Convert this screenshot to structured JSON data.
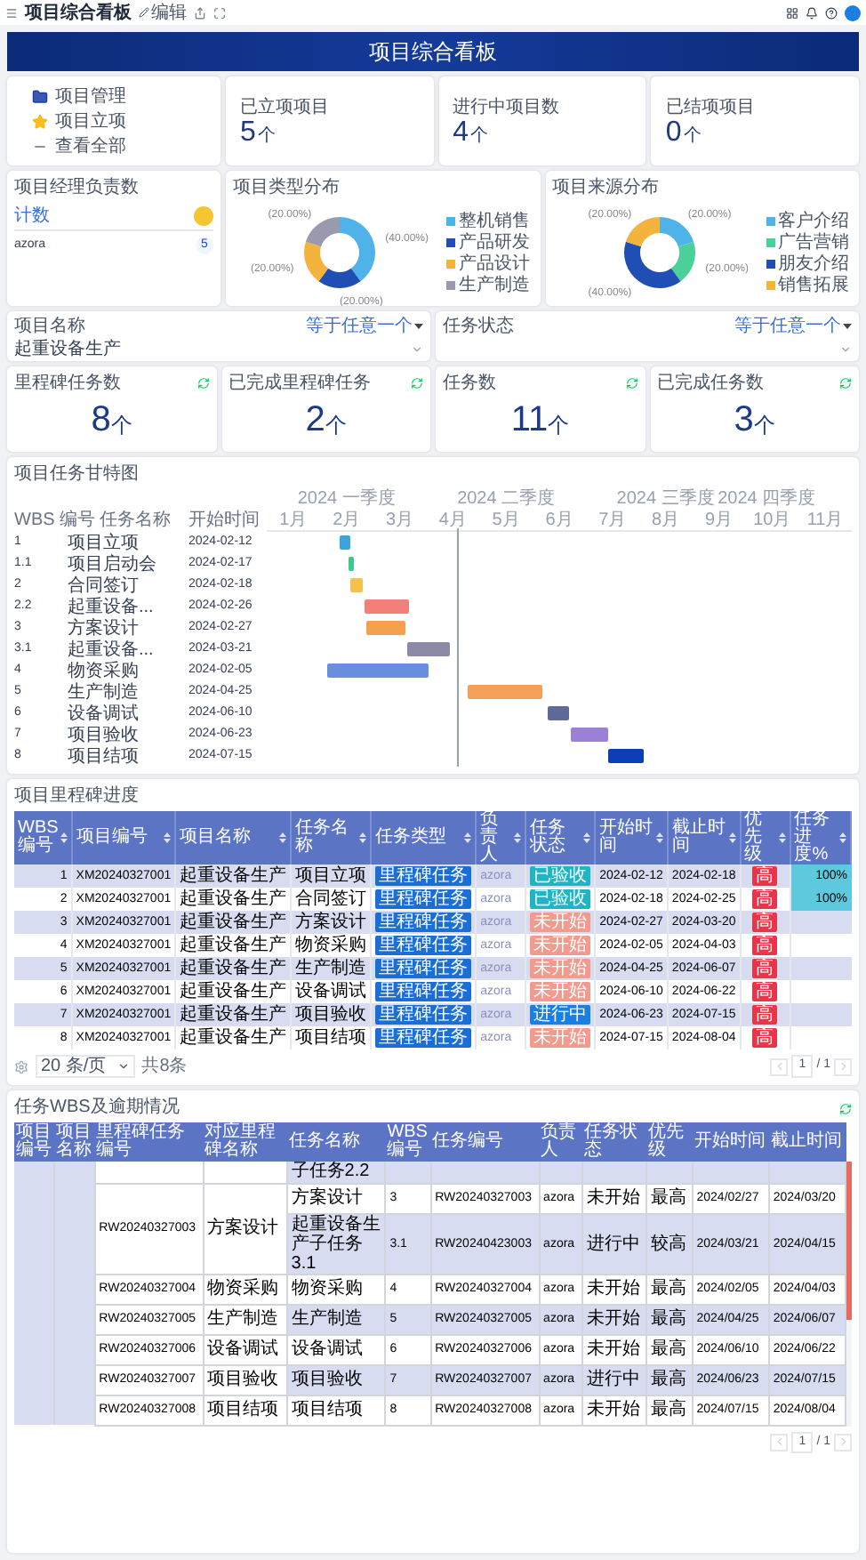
{
  "topbar": {
    "title": "项目综合看板",
    "edit": "编辑"
  },
  "banner": {
    "title": "项目综合看板"
  },
  "menu": [
    {
      "label": "项目管理",
      "kind": "folder"
    },
    {
      "label": "项目立项",
      "kind": "star"
    },
    {
      "label": "查看全部",
      "kind": "dash"
    }
  ],
  "stats": [
    {
      "label": "已立项项目",
      "value": "5",
      "unit": "个"
    },
    {
      "label": "进行中项目数",
      "value": "4",
      "unit": "个"
    },
    {
      "label": "已结项项目",
      "value": "0",
      "unit": "个"
    }
  ],
  "manager_counts": {
    "title": "项目经理负责数",
    "header": "计数",
    "rows": [
      {
        "name": "azora",
        "count": "5"
      }
    ]
  },
  "pies": [
    {
      "title": "项目类型分布",
      "chart_data": {
        "type": "donut",
        "categories": [
          "整机销售",
          "产品研发",
          "产品设计",
          "生产制造"
        ],
        "values": [
          40,
          20,
          20,
          20
        ],
        "legend": "right",
        "colors": [
          "#4fb3ea",
          "#1f4fb5",
          "#f3b33d",
          "#9a9aae"
        ],
        "value_labels": [
          "(40.00%)",
          "(20.00%)",
          "(20.00%)",
          "(20.00%)"
        ]
      }
    },
    {
      "title": "项目来源分布",
      "chart_data": {
        "type": "donut",
        "categories": [
          "客户介绍",
          "广告营销",
          "朋友介绍",
          "销售拓展"
        ],
        "values": [
          20,
          20,
          40,
          20
        ],
        "legend": "right",
        "colors": [
          "#4fb3ea",
          "#4cd09a",
          "#1f4fb5",
          "#f3b33d"
        ],
        "value_labels": [
          "(20.00%)",
          "(20.00%)",
          "(40.00%)",
          "(20.00%)"
        ]
      }
    }
  ],
  "filters": [
    {
      "label": "项目名称",
      "operator": "等于任意一个",
      "value": "起重设备生产"
    },
    {
      "label": "任务状态",
      "operator": "等于任意一个"
    }
  ],
  "counters": [
    {
      "label": "里程碑任务数",
      "value": "8",
      "unit": "个"
    },
    {
      "label": "已完成里程碑任务",
      "value": "2",
      "unit": "个"
    },
    {
      "label": "任务数",
      "value": "11",
      "unit": "个"
    },
    {
      "label": "已完成任务数",
      "value": "3",
      "unit": "个"
    }
  ],
  "gantt": {
    "title": "项目任务甘特图",
    "columns": [
      "WBS 编号",
      "任务名称",
      "开始时间"
    ],
    "quarters": [
      "2024 一季度",
      "2024 二季度",
      "2024 三季度",
      "2024 四季度"
    ],
    "months": [
      "1月",
      "2月",
      "3月",
      "4月",
      "5月",
      "6月",
      "7月",
      "8月",
      "9月",
      "10月",
      "11月"
    ],
    "tasks": [
      {
        "wbs": "1",
        "name": "项目立项",
        "start": "2024-02-12",
        "color": "#3ba4e0"
      },
      {
        "wbs": "1.1",
        "name": "项目启动会",
        "start": "2024-02-17",
        "color": "#3cc98a"
      },
      {
        "wbs": "2",
        "name": "合同签订",
        "start": "2024-02-18",
        "color": "#f5c04e"
      },
      {
        "wbs": "2.2",
        "name": "起重设备...",
        "start": "2024-02-26",
        "color": "#f27f7a"
      },
      {
        "wbs": "3",
        "name": "方案设计",
        "start": "2024-02-27",
        "color": "#f5a04f"
      },
      {
        "wbs": "3.1",
        "name": "起重设备...",
        "start": "2024-03-21",
        "color": "#8c8aa6"
      },
      {
        "wbs": "4",
        "name": "物资采购",
        "start": "2024-02-05",
        "color": "#6a8fe0"
      },
      {
        "wbs": "5",
        "name": "生产制造",
        "start": "2024-04-25",
        "color": "#f2a05a"
      },
      {
        "wbs": "6",
        "name": "设备调试",
        "start": "2024-06-10",
        "color": "#606a96"
      },
      {
        "wbs": "7",
        "name": "项目验收",
        "start": "2024-06-23",
        "color": "#9a80d6"
      },
      {
        "wbs": "8",
        "name": "项目结项",
        "start": "2024-07-15",
        "color": "#0b3fb5"
      }
    ]
  },
  "milestones": {
    "title": "项目里程碑进度",
    "columns": [
      "WBS编号",
      "项目编号",
      "项目名称",
      "任务名称",
      "任务类型",
      "负责人",
      "任务状态",
      "开始时间",
      "截止时间",
      "优先级",
      "任务进度%"
    ],
    "rows": [
      {
        "wbs": "1",
        "project_no": "XM20240327001",
        "project": "起重设备生产",
        "task": "项目立项",
        "type": "里程碑任务",
        "owner": "azora",
        "status": {
          "text": "已验收",
          "color": "#1fb5c4"
        },
        "start": "2024-02-12",
        "end": "2024-02-18",
        "priority": "高",
        "progress": {
          "text": "100%",
          "level": 1
        }
      },
      {
        "wbs": "2",
        "project_no": "XM20240327001",
        "project": "起重设备生产",
        "task": "合同签订",
        "type": "里程碑任务",
        "owner": "azora",
        "status": {
          "text": "已验收",
          "color": "#1fb5c4"
        },
        "start": "2024-02-18",
        "end": "2024-02-25",
        "priority": "高",
        "progress": {
          "text": "100%",
          "level": 1
        }
      },
      {
        "wbs": "3",
        "project_no": "XM20240327001",
        "project": "起重设备生产",
        "task": "方案设计",
        "type": "里程碑任务",
        "owner": "azora",
        "status": {
          "text": "未开始",
          "color": "#f29a8e"
        },
        "start": "2024-02-27",
        "end": "2024-03-20",
        "priority": "高"
      },
      {
        "wbs": "4",
        "project_no": "XM20240327001",
        "project": "起重设备生产",
        "task": "物资采购",
        "type": "里程碑任务",
        "owner": "azora",
        "status": {
          "text": "未开始",
          "color": "#f29a8e"
        },
        "start": "2024-02-05",
        "end": "2024-04-03",
        "priority": "高"
      },
      {
        "wbs": "5",
        "project_no": "XM20240327001",
        "project": "起重设备生产",
        "task": "生产制造",
        "type": "里程碑任务",
        "owner": "azora",
        "status": {
          "text": "未开始",
          "color": "#f29a8e"
        },
        "start": "2024-04-25",
        "end": "2024-06-07",
        "priority": "高"
      },
      {
        "wbs": "6",
        "project_no": "XM20240327001",
        "project": "起重设备生产",
        "task": "设备调试",
        "type": "里程碑任务",
        "owner": "azora",
        "status": {
          "text": "未开始",
          "color": "#f29a8e"
        },
        "start": "2024-06-10",
        "end": "2024-06-22",
        "priority": "高"
      },
      {
        "wbs": "7",
        "project_no": "XM20240327001",
        "project": "起重设备生产",
        "task": "项目验收",
        "type": "里程碑任务",
        "owner": "azora",
        "status": {
          "text": "进行中",
          "color": "#1a7fe0"
        },
        "start": "2024-06-23",
        "end": "2024-07-15",
        "priority": "高"
      },
      {
        "wbs": "8",
        "project_no": "XM20240327001",
        "project": "起重设备生产",
        "task": "项目结项",
        "type": "里程碑任务",
        "owner": "azora",
        "status": {
          "text": "未开始",
          "color": "#f29a8e"
        },
        "start": "2024-07-15",
        "end": "2024-08-04",
        "priority": "高"
      }
    ],
    "pagination": {
      "page_size": "20 条/页",
      "total": "共8条",
      "page": "1",
      "pages": "/ 1"
    }
  },
  "wbs": {
    "title": "任务WBS及逾期情况",
    "columns": [
      "项目编号",
      "项目名称",
      "里程碑任务编号",
      "对应里程碑名称",
      "任务名称",
      "WBS编号",
      "任务编号",
      "负责人",
      "任务状态",
      "优先级",
      "开始时间",
      "截止时间"
    ],
    "groups": [
      {
        "tasks": [
          {
            "name": "子任务2.2"
          }
        ]
      },
      {
        "milestone_no": "RW20240327003",
        "milestone": "方案设计",
        "tasks": [
          {
            "name": "方案设计",
            "wbs": "3",
            "task_no": "RW20240327003",
            "owner": "azora",
            "status": "未开始",
            "priority": "最高",
            "start": "2024/02/27",
            "end": "2024/03/20"
          },
          {
            "name": "起重设备生产子任务3.1",
            "wbs": "3.1",
            "task_no": "RW20240423003",
            "owner": "azora",
            "status": "进行中",
            "priority": "较高",
            "start": "2024/03/21",
            "end": "2024/04/15"
          }
        ]
      },
      {
        "milestone_no": "RW20240327004",
        "milestone": "物资采购",
        "tasks": [
          {
            "name": "物资采购",
            "wbs": "4",
            "task_no": "RW20240327004",
            "owner": "azora",
            "status": "未开始",
            "priority": "最高",
            "start": "2024/02/05",
            "end": "2024/04/03"
          }
        ]
      },
      {
        "milestone_no": "RW20240327005",
        "milestone": "生产制造",
        "tasks": [
          {
            "name": "生产制造",
            "wbs": "5",
            "task_no": "RW20240327005",
            "owner": "azora",
            "status": "未开始",
            "priority": "最高",
            "start": "2024/04/25",
            "end": "2024/06/07"
          }
        ]
      },
      {
        "milestone_no": "RW20240327006",
        "milestone": "设备调试",
        "tasks": [
          {
            "name": "设备调试",
            "wbs": "6",
            "task_no": "RW20240327006",
            "owner": "azora",
            "status": "未开始",
            "priority": "最高",
            "start": "2024/06/10",
            "end": "2024/06/22"
          }
        ]
      },
      {
        "milestone_no": "RW20240327007",
        "milestone": "项目验收",
        "tasks": [
          {
            "name": "项目验收",
            "wbs": "7",
            "task_no": "RW20240327007",
            "owner": "azora",
            "status": "进行中",
            "priority": "最高",
            "start": "2024/06/23",
            "end": "2024/07/15"
          }
        ]
      },
      {
        "milestone_no": "RW20240327008",
        "milestone": "项目结项",
        "tasks": [
          {
            "name": "项目结项",
            "wbs": "8",
            "task_no": "RW20240327008",
            "owner": "azora",
            "status": "未开始",
            "priority": "最高",
            "start": "2024/07/15",
            "end": "2024/08/04"
          }
        ]
      }
    ],
    "pagination": {
      "page": "1",
      "pages": "/ 1"
    }
  }
}
